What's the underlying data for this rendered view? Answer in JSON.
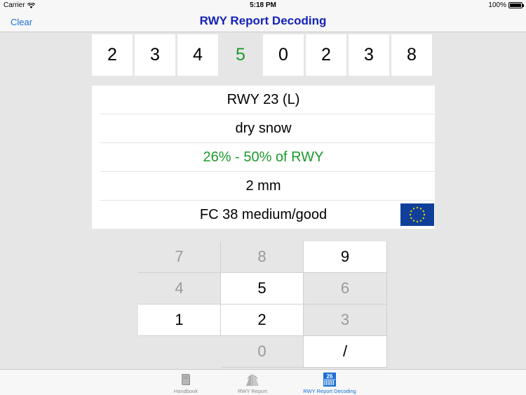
{
  "status_bar": {
    "carrier": "Carrier",
    "time": "5:18 PM",
    "battery": "100%"
  },
  "nav": {
    "clear_label": "Clear",
    "title": "RWY Report Decoding"
  },
  "digits": [
    {
      "value": "2",
      "active": false
    },
    {
      "value": "3",
      "active": false
    },
    {
      "value": "4",
      "active": false
    },
    {
      "value": "5",
      "active": true
    },
    {
      "value": "0",
      "active": false
    },
    {
      "value": "2",
      "active": false
    },
    {
      "value": "3",
      "active": false
    },
    {
      "value": "8",
      "active": false
    }
  ],
  "decoded": {
    "runway": "RWY 23 (L)",
    "deposit": "dry snow",
    "coverage": "26% - 50% of RWY",
    "depth": "2 mm",
    "friction": "FC 38 medium/good"
  },
  "keypad": [
    {
      "label": "7",
      "enabled": false
    },
    {
      "label": "8",
      "enabled": false
    },
    {
      "label": "9",
      "enabled": true
    },
    {
      "label": "4",
      "enabled": false
    },
    {
      "label": "5",
      "enabled": true
    },
    {
      "label": "6",
      "enabled": false
    },
    {
      "label": "1",
      "enabled": true
    },
    {
      "label": "2",
      "enabled": true
    },
    {
      "label": "3",
      "enabled": false
    },
    {
      "label": "",
      "enabled": false,
      "empty": true
    },
    {
      "label": "0",
      "enabled": false
    },
    {
      "label": "/",
      "enabled": true
    }
  ],
  "tabs": [
    {
      "label": "Handbook",
      "icon": "book-icon",
      "selected": false
    },
    {
      "label": "RWY Report",
      "icon": "runway-report-icon",
      "selected": false
    },
    {
      "label": "RWY Report Decoding",
      "icon": "calendar-decoding-icon",
      "selected": true,
      "icon_text": "26"
    }
  ],
  "colors": {
    "accent": "#1a6fd8",
    "title": "#1422b8",
    "highlight": "#1d9a2c",
    "eu_blue": "#103f99",
    "eu_star": "#f5d20a"
  }
}
